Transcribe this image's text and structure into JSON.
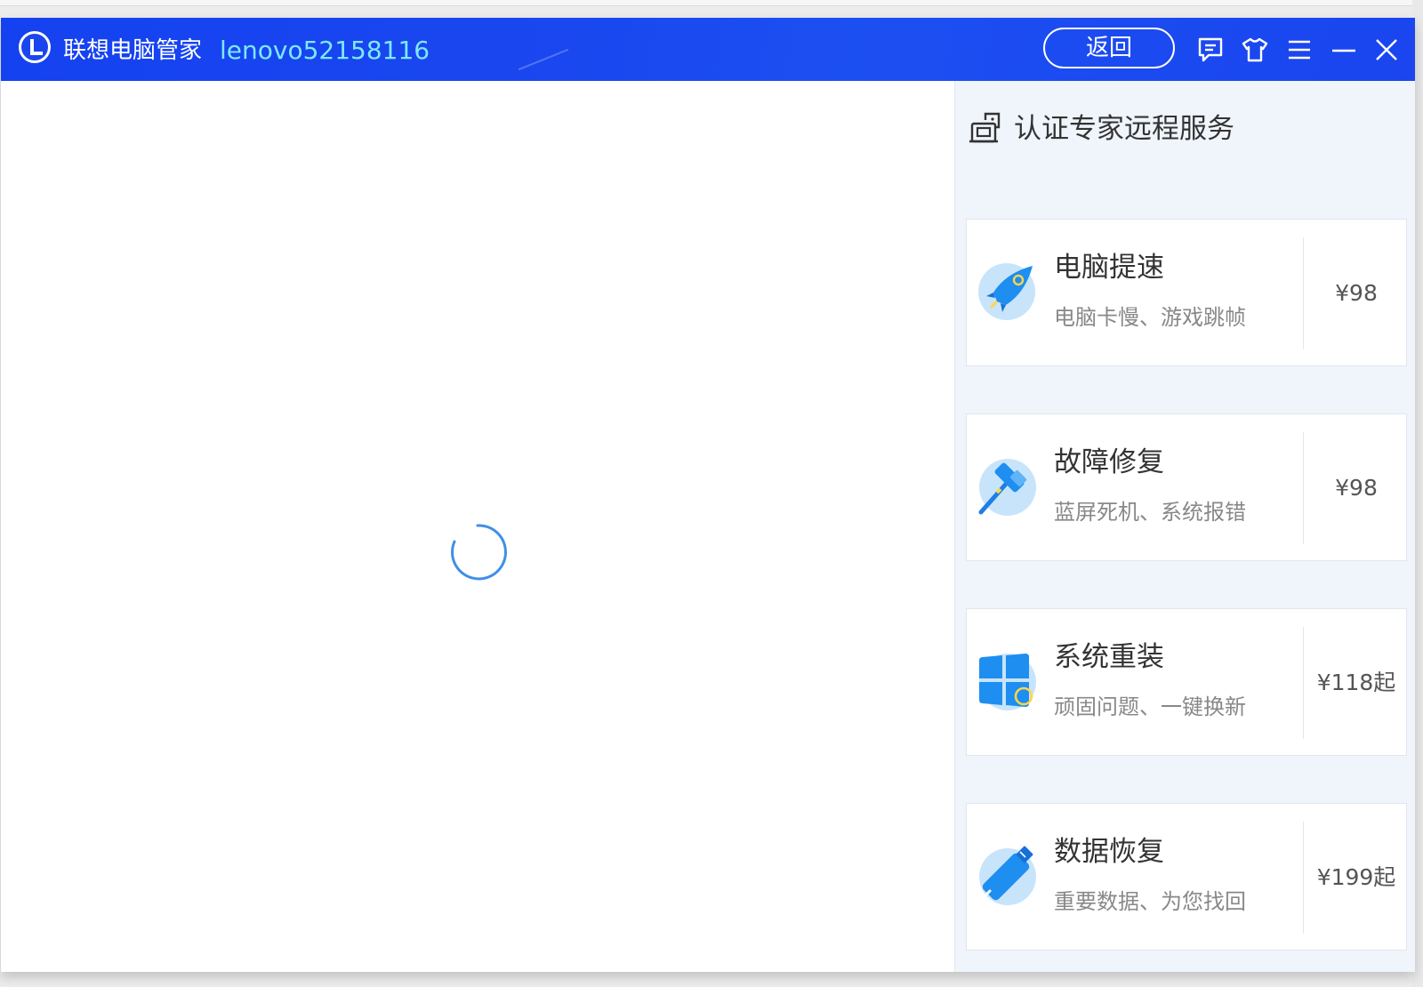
{
  "window": {
    "title": "联想电脑管家",
    "user": "lenovo52158116",
    "back_label": "返回",
    "accent": "#1846ef",
    "user_color": "#7de8ff"
  },
  "titlebar_icons": [
    "feedback-icon",
    "skin-icon",
    "menu-icon",
    "minimize-icon",
    "close-icon"
  ],
  "main": {
    "state": "loading"
  },
  "panel": {
    "title": "认证专家远程服务",
    "background": "#f0f5fc",
    "services": [
      {
        "name": "电脑提速",
        "desc": "电脑卡慢、游戏跳帧",
        "price": "¥98",
        "icon": "rocket-icon"
      },
      {
        "name": "故障修复",
        "desc": "蓝屏死机、系统报错",
        "price": "¥98",
        "icon": "hammer-icon"
      },
      {
        "name": "系统重装",
        "desc": "顽固问题、一键换新",
        "price": "¥118起",
        "icon": "windows-icon"
      },
      {
        "name": "数据恢复",
        "desc": "重要数据、为您找回",
        "price": "¥199起",
        "icon": "usb-drive-icon"
      }
    ]
  }
}
